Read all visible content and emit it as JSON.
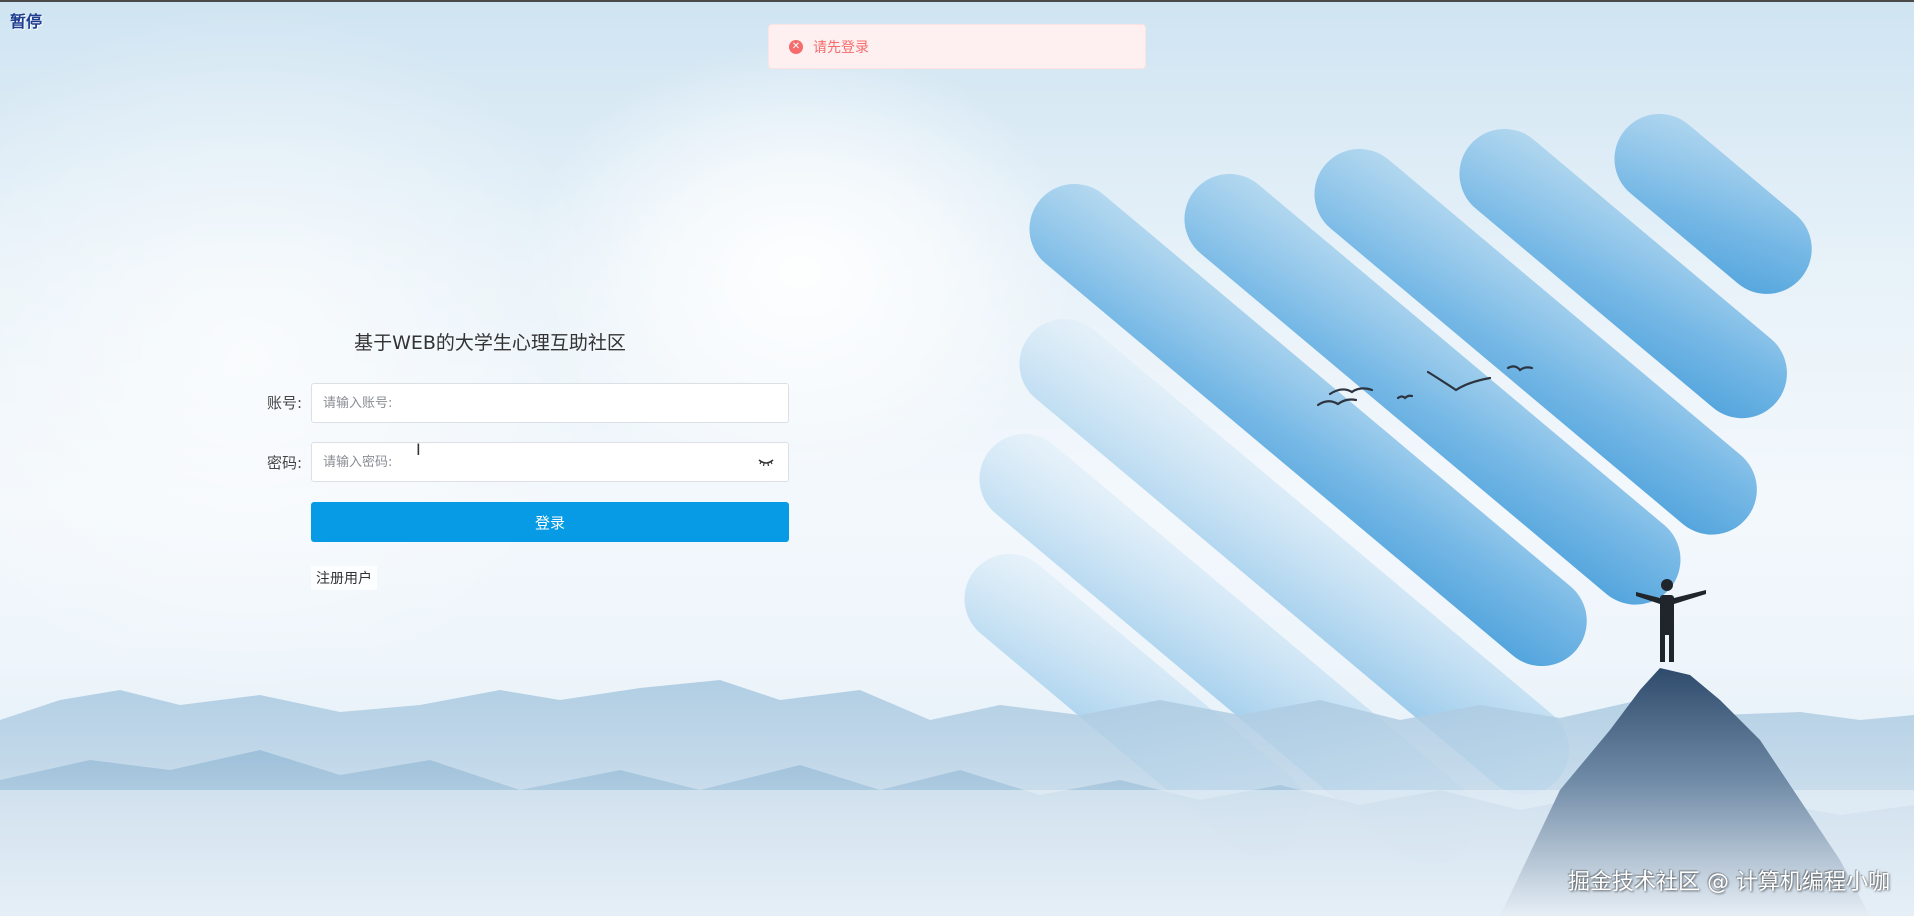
{
  "overlay": {
    "pause_label": "暂停"
  },
  "toast": {
    "message": "请先登录",
    "icon": "close-circle-icon",
    "color": "#f56c6c"
  },
  "login_form": {
    "title": "基于WEB的大学生心理互助社区",
    "account_label": "账号:",
    "account_placeholder": "请输入账号:",
    "password_label": "密码:",
    "password_placeholder": "请输入密码:",
    "login_button": "登录",
    "register_link": "注册用户",
    "accent_color": "#079be6"
  },
  "watermark": {
    "text": "掘金技术社区 @ 计算机编程小咖"
  }
}
